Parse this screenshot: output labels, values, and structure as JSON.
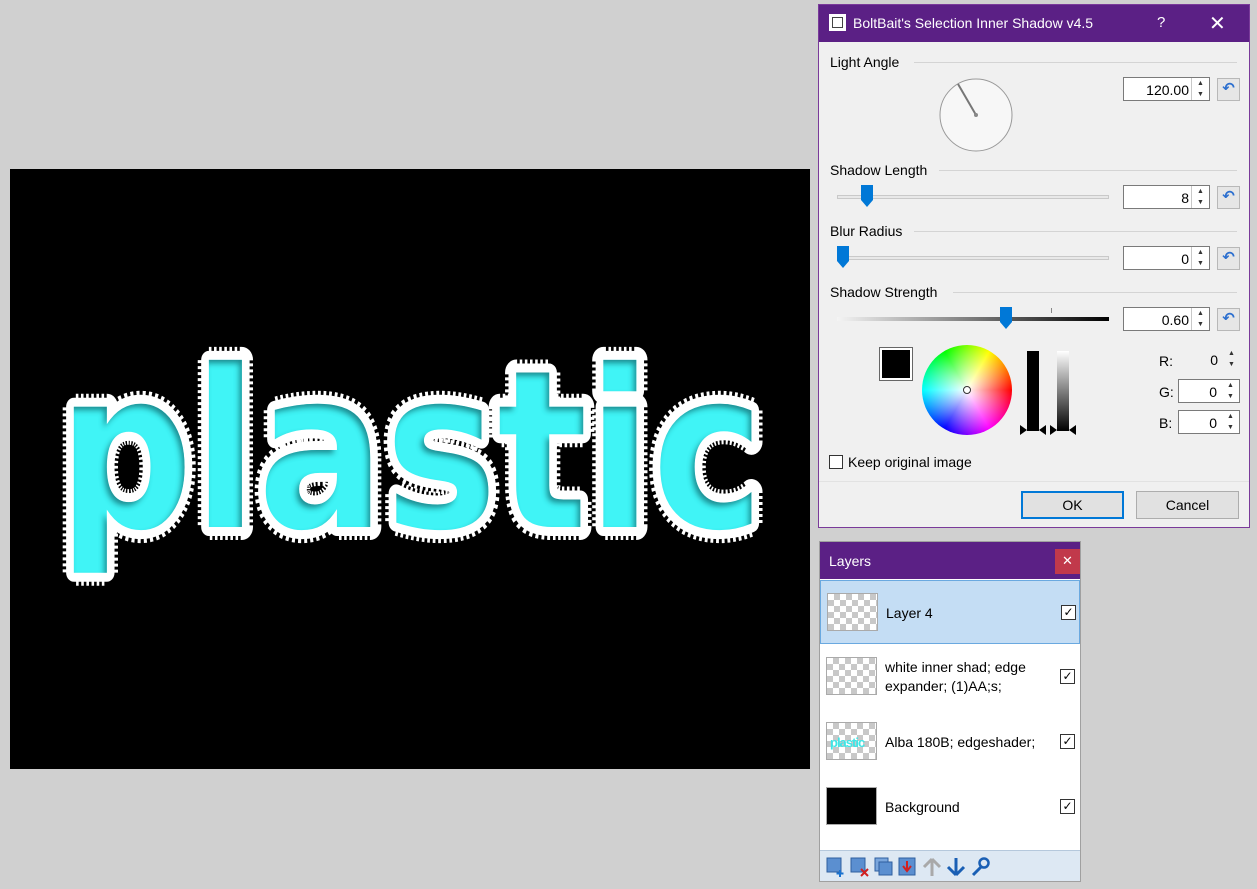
{
  "canvas": {
    "text": "plastic",
    "fill_color": "#3ff4f6",
    "background_color": "#000000"
  },
  "dialog": {
    "title": "BoltBait's Selection Inner Shadow v4.5",
    "help_icon": "?",
    "close_icon": "✕",
    "light_angle": {
      "label": "Light Angle",
      "value": "120.00"
    },
    "shadow_length": {
      "label": "Shadow Length",
      "value": "8",
      "fraction": 0.09
    },
    "blur_radius": {
      "label": "Blur Radius",
      "value": "0",
      "fraction": 0.0
    },
    "shadow_strength": {
      "label": "Shadow Strength",
      "value": "0.60",
      "fraction": 0.6
    },
    "color": {
      "swatch": "#000000",
      "r_label": "R:",
      "r_value": "0",
      "g_label": "G:",
      "g_value": "0",
      "b_label": "B:",
      "b_value": "0"
    },
    "keep_original": {
      "label": "Keep original image",
      "checked": false
    },
    "ok_label": "OK",
    "cancel_label": "Cancel"
  },
  "layers": {
    "title": "Layers",
    "close_icon": "✕",
    "items": [
      {
        "name": "Layer 4",
        "visible": true,
        "selected": true
      },
      {
        "name": "white inner shad; edge expander; (1)AA;s;",
        "visible": true,
        "selected": false
      },
      {
        "name": "Alba 180B; edgeshader;",
        "visible": true,
        "selected": false,
        "thumb_text": "plastic"
      },
      {
        "name": "Background",
        "visible": true,
        "selected": false
      }
    ],
    "check_mark": "✓",
    "toolbar": [
      "add-layer-icon",
      "delete-layer-icon",
      "duplicate-layer-icon",
      "merge-layer-down-icon",
      "move-layer-up-icon",
      "move-layer-down-icon",
      "layer-properties-icon"
    ]
  },
  "colors": {
    "titlebar": "#5b2085",
    "accent": "#0078d7",
    "selection": "#c4ddf4",
    "close_red": "#c1394b"
  }
}
